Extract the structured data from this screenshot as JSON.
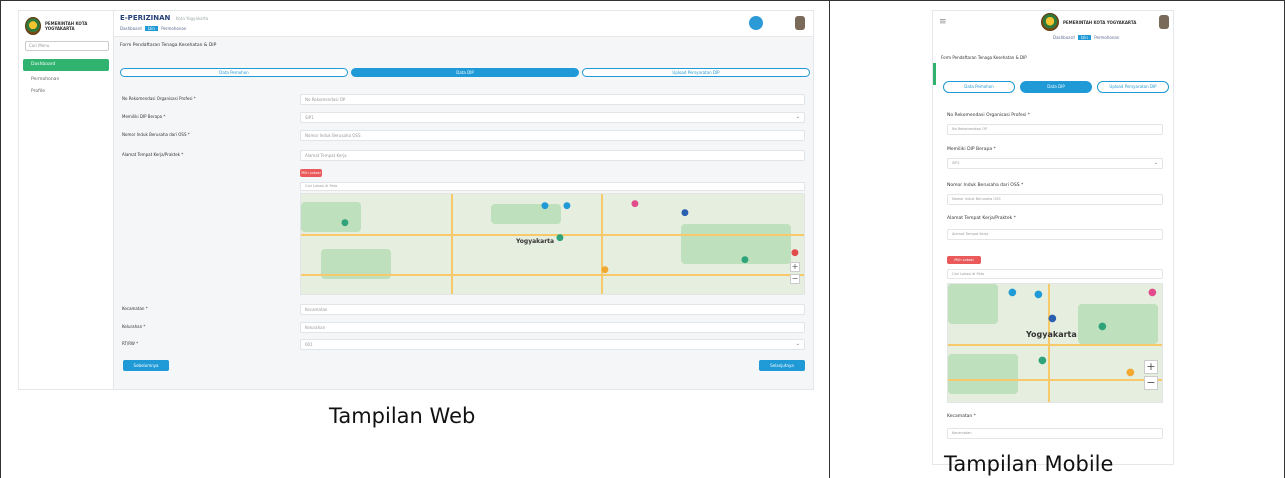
{
  "captions": {
    "web": "Tampilan Web",
    "mobile": "Tampilan Mobile"
  },
  "web": {
    "brand": "PEMERINTAH KOTA YOGYAKARTA",
    "search_placeholder": "Cari Menu",
    "menu": [
      {
        "label": "Dashboard"
      },
      {
        "label": "Permohonan"
      },
      {
        "label": "Profile"
      }
    ],
    "page_title": "E-PERIZINAN",
    "page_subtitle": "Kota Yogyakarta",
    "breadcrumb": {
      "home": "Dashboard",
      "tag": "Izin",
      "current": "Permohonan"
    },
    "form_title": "Form Pendaftaran Tenaga Kesehatan & DIP",
    "tabs": [
      {
        "label": "Data Pemohon"
      },
      {
        "label": "Data DIP",
        "active": true
      },
      {
        "label": "Upload Persyaratan DIP"
      }
    ],
    "fields": [
      {
        "label": "No Rekomendasi Organisasi Profesi *",
        "placeholder": "No Rekomendasi OP"
      },
      {
        "label": "Memiliki DIP Berapa *",
        "value": "SIP1"
      },
      {
        "label": "Nomor Induk Berusaha dari OSS *",
        "placeholder": "Nomor Induk Berusaha OSS"
      },
      {
        "label": "Alamat Tempat Kerja/Praktek *",
        "placeholder": "Alamat Tempat Kerja"
      }
    ],
    "lokasi_button": "Pilih Lokasi",
    "map_search_placeholder": "Cari Lokasi di Peta",
    "map_city": "Yogyakarta",
    "bottom_fields": [
      {
        "label": "Kecamatan *",
        "placeholder": "Kecamatan"
      },
      {
        "label": "Kelurahan *",
        "placeholder": "Kelurahan"
      },
      {
        "label": "RT/RW *",
        "value": "001"
      }
    ],
    "back_button": "Sebelumnya",
    "next_button": "Selanjutnya"
  },
  "mobile": {
    "brand": "PEMERINTAH KOTA YOGYAKARTA",
    "breadcrumb": {
      "home": "Dashboard",
      "tag": "Izin",
      "current": "Permohonan"
    },
    "form_title": "Form Pendaftaran Tenaga Kesehatan & DIP",
    "tabs": [
      {
        "label": "Data Pemohon"
      },
      {
        "label": "Data DIP",
        "active": true
      },
      {
        "label": "Upload Persyaratan DIP"
      }
    ],
    "fields": [
      {
        "label": "No Rekomendasi Organisasi Profesi *",
        "placeholder": "No Rekomendasi OP"
      },
      {
        "label": "Memiliki DIP Berapa *",
        "value": "SIP1"
      },
      {
        "label": "Nomor Induk Berusaha dari OSS *",
        "placeholder": "Nomor Induk Berusaha OSS"
      },
      {
        "label": "Alamat Tempat Kerja/Praktek *",
        "placeholder": "Alamat Tempat Kerja"
      }
    ],
    "lokasi_button": "Pilih Lokasi",
    "map_search_placeholder": "Cari Lokasi di Peta",
    "map_city": "Yogyakarta",
    "kecamatan_label": "Kecamatan *",
    "kecamatan_placeholder": "Kecamatan"
  }
}
